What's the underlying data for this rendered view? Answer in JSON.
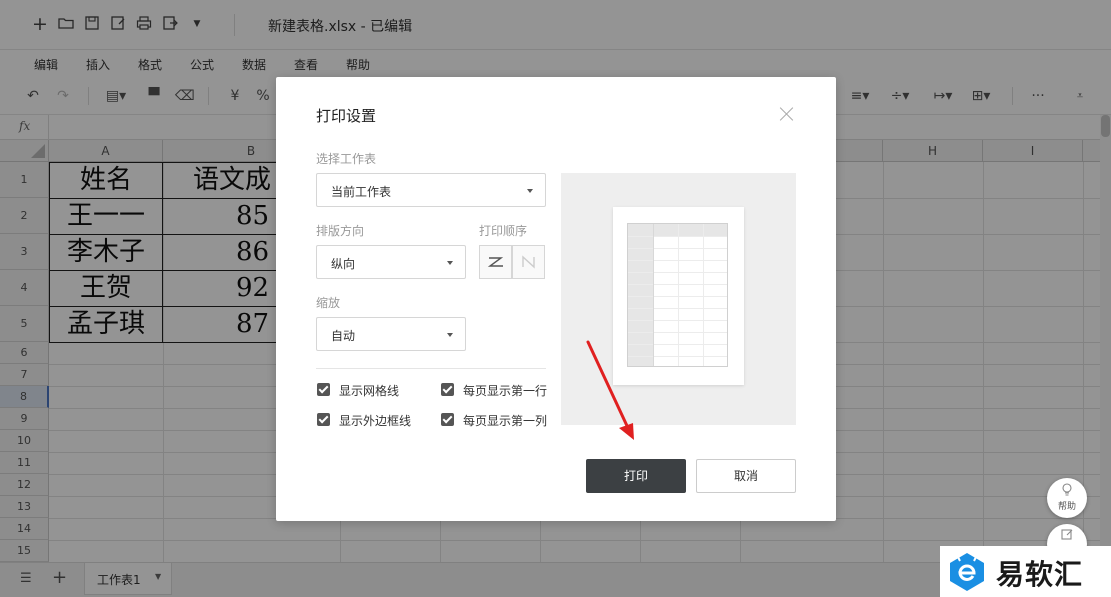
{
  "titlebar": {
    "doc_title": "新建表格.xlsx - 已编辑",
    "icons": [
      "plus-icon",
      "folder-icon",
      "save-icon",
      "save-as-icon",
      "print-icon",
      "export-icon",
      "more-caret-icon"
    ]
  },
  "menu": {
    "items": [
      "编辑",
      "插入",
      "格式",
      "公式",
      "数据",
      "查看",
      "帮助"
    ]
  },
  "toolbar": {
    "currency_label": "¥",
    "percent_label": "%",
    "more_label": "···"
  },
  "formula": {
    "fx_label": "fx"
  },
  "grid": {
    "columns": [
      "A",
      "B",
      "H",
      "I"
    ],
    "rows": [
      "1",
      "2",
      "3",
      "4",
      "5",
      "6",
      "7",
      "8",
      "9",
      "10",
      "11",
      "12",
      "13",
      "14",
      "15"
    ],
    "cells": [
      [
        "姓名",
        "语文成"
      ],
      [
        "王一一",
        "85"
      ],
      [
        "李木子",
        "86"
      ],
      [
        "王贺",
        "92"
      ],
      [
        "孟子琪",
        "87"
      ]
    ]
  },
  "sheets": {
    "active_tab": "工作表1"
  },
  "dialog": {
    "title": "打印设置",
    "worksheet_label": "选择工作表",
    "worksheet_value": "当前工作表",
    "orientation_label": "排版方向",
    "orientation_value": "纵向",
    "print_order_label": "打印顺序",
    "scale_label": "缩放",
    "scale_value": "自动",
    "checkboxes": {
      "show_gridlines": "显示网格线",
      "show_border": "显示外边框线",
      "repeat_first_row": "每页显示第一行",
      "repeat_first_col": "每页显示第一列"
    },
    "print_button": "打印",
    "cancel_button": "取消"
  },
  "help": {
    "label": "帮助"
  },
  "watermark": {
    "text": "易软汇"
  },
  "colors": {
    "primary_button": "#3c4043",
    "arrow": "#e02020",
    "overlay": "rgba(0,0,0,0.42)",
    "selected_row": "#4a76c5"
  }
}
